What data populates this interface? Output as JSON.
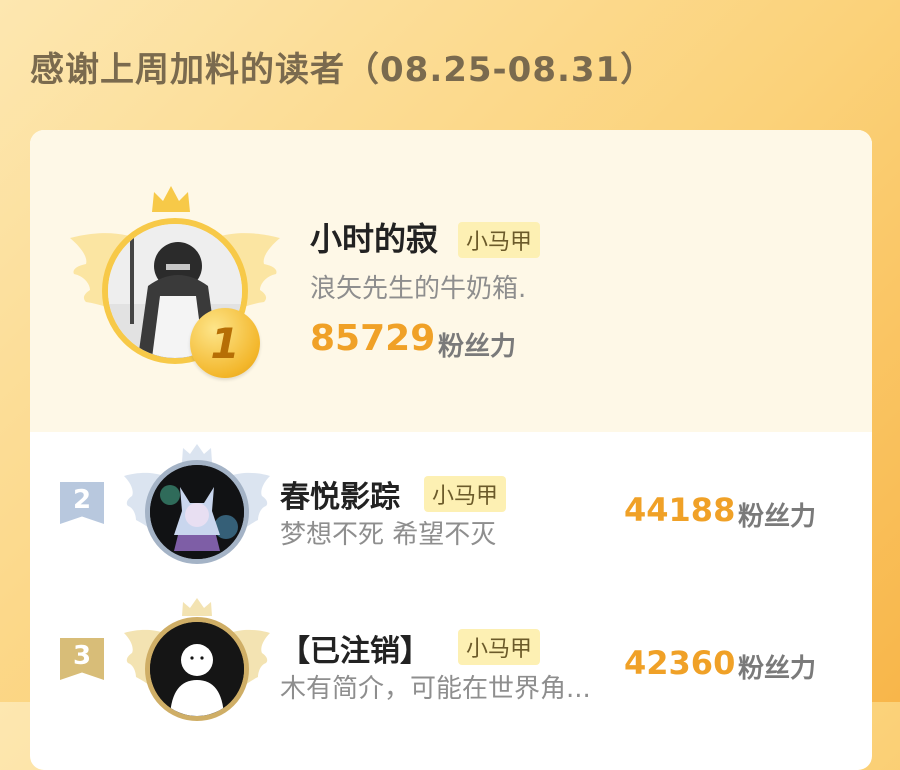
{
  "header": {
    "title": "感谢上周加料的读者（08.25-08.31）"
  },
  "colors": {
    "accent_orange": "#f0a127",
    "gold": "#f7c948",
    "silver": "#a4b3c6",
    "bronze": "#cfae66",
    "tag_bg": "#fdf0b3"
  },
  "readers": [
    {
      "rank": "1",
      "name": "小时的寂",
      "tag": "小马甲",
      "bio": "浪矢先生的牛奶箱.",
      "score": "85729",
      "unit": "粉丝力"
    },
    {
      "rank": "2",
      "name": "春悦影踪",
      "tag": "小马甲",
      "bio": "梦想不死 希望不灭",
      "score": "44188",
      "unit": "粉丝力"
    },
    {
      "rank": "3",
      "name": "【已注销】",
      "tag": "小马甲",
      "bio": "木有简介，可能在世界角...",
      "score": "42360",
      "unit": "粉丝力"
    }
  ],
  "icons": [
    "crown-icon",
    "wing-icon",
    "rank-medal-icon",
    "default-avatar-icon"
  ]
}
